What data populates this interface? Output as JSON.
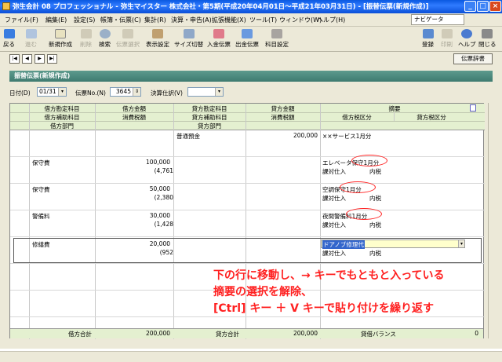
{
  "window": {
    "title": "弥生会計 08 プロフェッショナル - 弥生マイスター 株式会社・第5期(平成20年04月01日～平成21年03月31日) - [振替伝票(新規作成)]",
    "min": "_",
    "max": "□",
    "close": "×"
  },
  "menu": [
    "ファイル(F)",
    "編集(E)",
    "設定(S)",
    "帳簿・伝票(C)",
    "集計(R)",
    "決算・申告(A)",
    "拡張機能(X)",
    "ツール(T)",
    "ウィンドウ(W)",
    "ヘルプ(H)"
  ],
  "navi": "ナビゲータ",
  "toolbar": {
    "left": [
      {
        "label": "戻る",
        "disabled": false
      },
      {
        "label": "進む",
        "disabled": true
      },
      {
        "label": "新規作成",
        "disabled": false
      },
      {
        "label": "削除",
        "disabled": true
      },
      {
        "label": "検索",
        "disabled": false
      },
      {
        "label": "伝票選択",
        "disabled": true
      },
      {
        "label": "表示設定",
        "disabled": false
      },
      {
        "label": "サイズ切替",
        "disabled": false
      },
      {
        "label": "入金伝票",
        "disabled": false
      },
      {
        "label": "出金伝票",
        "disabled": false
      },
      {
        "label": "科目設定",
        "disabled": false
      }
    ],
    "right": [
      {
        "label": "登録",
        "disabled": false
      },
      {
        "label": "印刷",
        "disabled": true
      },
      {
        "label": "ヘルプ",
        "disabled": false
      },
      {
        "label": "閉じる",
        "disabled": false
      }
    ]
  },
  "nav": {
    "first": "|◀",
    "prev": "◀",
    "next": "▶",
    "last": "▶|",
    "dict": "伝票辞書"
  },
  "form": {
    "title": "振替伝票(新規作成)",
    "date_label": "日付(D)",
    "date_value": "01/31",
    "no_label": "伝票No.(N)",
    "no_value": "3645",
    "kessan_label": "決算仕訳(V)",
    "kessan_value": ""
  },
  "grid": {
    "headers": {
      "row1": [
        "借方勘定科目",
        "借方金額",
        "貸方勘定科目",
        "貸方金額",
        "摘要"
      ],
      "row2": [
        "借方補助科目",
        "消費税額",
        "貸方補助科目",
        "消費税額",
        "借方税区分",
        "貸方税区分"
      ],
      "row3": [
        "借方部門",
        "",
        "貸方部門"
      ]
    },
    "entries": [
      {
        "debit": "",
        "debit_amount": "",
        "debit_tax": "",
        "credit": "普通預金",
        "credit_amount": "200,000",
        "desc": "××サービス1月分",
        "debit_taxcat": "",
        "credit_taxcat": ""
      },
      {
        "debit": "保守費",
        "debit_amount": "100,000",
        "debit_tax": "(4,761",
        "credit": "",
        "credit_amount": "",
        "desc": "エレベータ保守1月分",
        "debit_taxcat": "課対仕入",
        "credit_taxcat": "内税"
      },
      {
        "debit": "保守費",
        "debit_amount": "50,000",
        "debit_tax": "(2,380",
        "credit": "",
        "credit_amount": "",
        "desc": "空調保守1月分",
        "debit_taxcat": "課対仕入",
        "credit_taxcat": "内税"
      },
      {
        "debit": "警備料",
        "debit_amount": "30,000",
        "debit_tax": "(1,428",
        "credit": "",
        "credit_amount": "",
        "desc": "夜間警備料1月分",
        "debit_taxcat": "課対仕入",
        "credit_taxcat": "内税"
      },
      {
        "debit": "修繕費",
        "debit_amount": "20,000",
        "debit_tax": "(952",
        "credit": "",
        "credit_amount": "",
        "desc": "ドアノブ修理代",
        "debit_taxcat": "課対仕入",
        "credit_taxcat": "内税"
      }
    ],
    "totals": {
      "debit_label": "借方合計",
      "debit_value": "200,000",
      "credit_label": "貸方合計",
      "credit_value": "200,000",
      "balance_label": "貸借バランス",
      "balance_value": "0"
    }
  },
  "callout": [
    "下の行に移動し、→ キーでもともと入っている",
    "摘要の選択を解除、",
    "[Ctrl] キー ＋ V キーで貼り付けを繰り返す"
  ],
  "colors": {
    "titlebar": "#0a58e0",
    "header_bg": "#e4f0d0",
    "form_title": "#3e7b70",
    "annotation": "#ff2020",
    "selected_desc": "#3366cc",
    "highlight_row": "#ffffcc"
  }
}
